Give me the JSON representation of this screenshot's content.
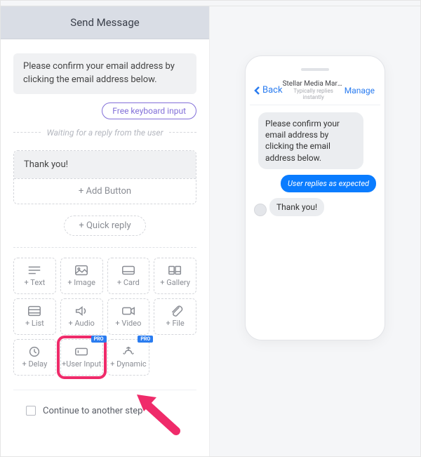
{
  "header": {
    "title": "Send Message"
  },
  "messages": {
    "confirm_text": "Please confirm your email address by clicking the email address below.",
    "keyboard_chip": "Free keyboard input",
    "wait_divider": "Waiting for a reply from the user",
    "thankyou_text": "Thank you!",
    "add_button_label": "+ Add Button",
    "quick_reply_label": "+ Quick reply"
  },
  "blocks": {
    "text": "+ Text",
    "image": "+ Image",
    "card": "+ Card",
    "gallery": "+ Gallery",
    "list": "+ List",
    "audio": "+ Audio",
    "video": "+ Video",
    "file": "+ File",
    "delay": "+ Delay",
    "user_input": "+User Input",
    "dynamic": "+ Dynamic",
    "pro_badge": "PRO"
  },
  "footer": {
    "continue_label": "Continue to another step"
  },
  "preview": {
    "back_label": "Back",
    "page_name": "Stellar Media Marketi...",
    "subtitle": "Typically replies instantly",
    "manage_label": "Manage",
    "msg1": "Please confirm your email address by clicking the email address below.",
    "user_reply": "User replies as expected",
    "msg2": "Thank you!"
  }
}
